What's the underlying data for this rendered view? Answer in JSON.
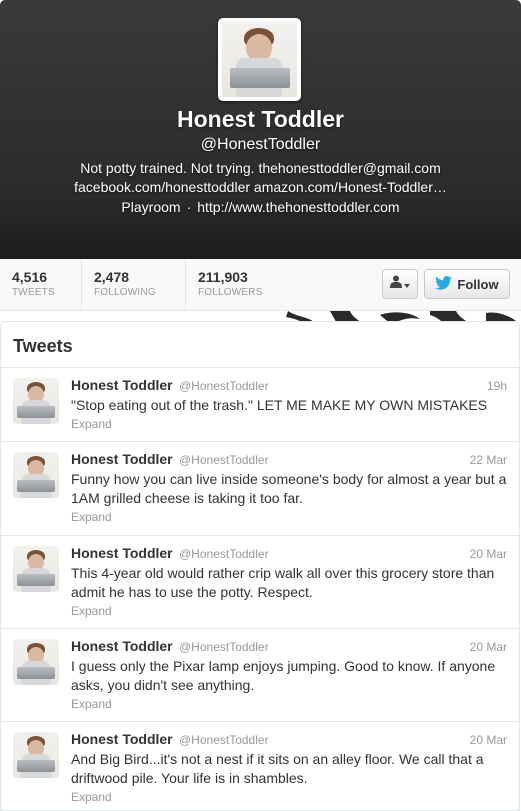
{
  "profile": {
    "name": "Honest Toddler",
    "handle": "@HonestToddler",
    "bio_line1": "Not potty trained. Not trying. thehonesttoddler@gmail.com",
    "bio_line2": "facebook.com/honesttoddler amazon.com/Honest-Toddler…",
    "location": "Playroom",
    "separator": "·",
    "url": "http://www.thehonesttoddler.com"
  },
  "stats": [
    {
      "value": "4,516",
      "label": "TWEETS"
    },
    {
      "value": "2,478",
      "label": "FOLLOWING"
    },
    {
      "value": "211,903",
      "label": "FOLLOWERS"
    }
  ],
  "actions": {
    "user_menu_icon": "person-icon",
    "follow_label": "Follow",
    "follow_icon": "bird-icon"
  },
  "tweets_section": {
    "title": "Tweets",
    "items": [
      {
        "name": "Honest Toddler",
        "handle": "@HonestToddler",
        "time": "19h",
        "text": "\"Stop eating out of the trash.\" LET ME MAKE MY OWN MISTAKES",
        "expand": "Expand"
      },
      {
        "name": "Honest Toddler",
        "handle": "@HonestToddler",
        "time": "22 Mar",
        "text": "Funny how you can live inside someone's body for almost a year but a 1AM grilled cheese is taking it too far.",
        "expand": "Expand"
      },
      {
        "name": "Honest Toddler",
        "handle": "@HonestToddler",
        "time": "20 Mar",
        "text": "This 4-year old would rather crip walk all over this grocery store than admit he has to use the potty. Respect.",
        "expand": "Expand"
      },
      {
        "name": "Honest Toddler",
        "handle": "@HonestToddler",
        "time": "20 Mar",
        "text": "I guess only the Pixar lamp enjoys jumping. Good to know. If anyone asks, you didn't see anything.",
        "expand": "Expand"
      },
      {
        "name": "Honest Toddler",
        "handle": "@HonestToddler",
        "time": "20 Mar",
        "text": "And Big Bird...it's not a nest if it sits on an alley floor. We call that a driftwood pile. Your life is in shambles.",
        "expand": "Expand"
      }
    ]
  },
  "colors": {
    "header_bg": "#2e2e2e",
    "twitter_blue": "#2aa9e0",
    "muted_text": "#999999"
  }
}
